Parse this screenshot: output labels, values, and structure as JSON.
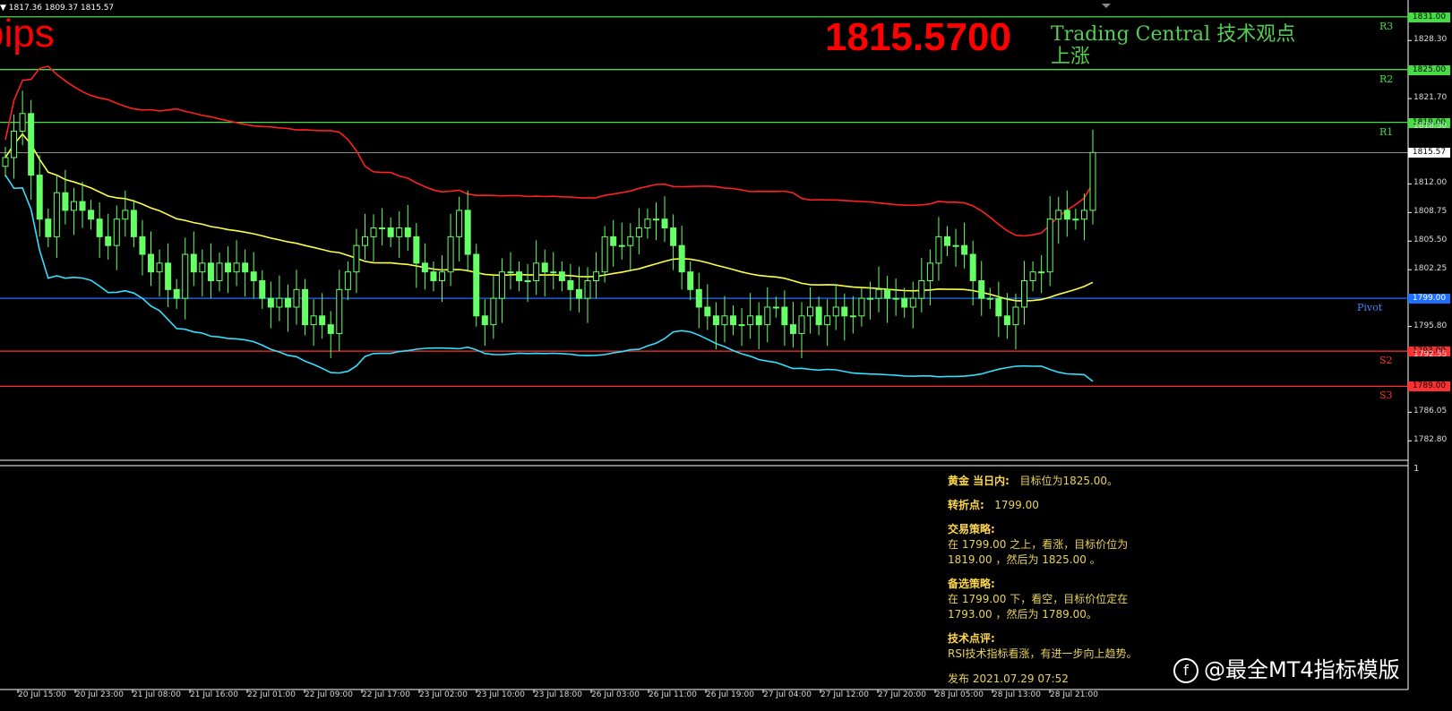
{
  "header": {
    "ohlc_text": "▼ 1817.36 1809.37 1815.57",
    "pips_label": "pips",
    "big_price": "1815.5700",
    "tc_line1": "Trading Central 技术观点",
    "tc_line2": "上涨"
  },
  "levels": [
    {
      "name": "R3",
      "value": 1831.0,
      "tag": "1831.00",
      "color": "#44dd44"
    },
    {
      "name": "R2",
      "value": 1825.0,
      "tag": "1825.00",
      "color": "#44dd44"
    },
    {
      "name": "R1",
      "value": 1819.0,
      "tag": "1819.00",
      "color": "#44dd44"
    },
    {
      "name": "Pivot",
      "value": 1799.0,
      "tag": "1799.00",
      "color": "#1e6fff"
    },
    {
      "name": "S2",
      "value": 1793.0,
      "tag": "1793.00",
      "color": "#ff3030"
    },
    {
      "name": "S3",
      "value": 1789.0,
      "tag": "1789.00",
      "color": "#ff3030"
    }
  ],
  "current_price": {
    "value": 1815.57,
    "tag": "1815.57"
  },
  "y_axis_ticks": [
    "1828.30",
    "1821.70",
    "1818.50",
    "1812.00",
    "1808.75",
    "1805.50",
    "1802.25",
    "1795.80",
    "1792.55",
    "1786.05",
    "1782.80"
  ],
  "x_axis_labels": [
    "20 Jul 15:00",
    "20 Jul 23:00",
    "21 Jul 08:00",
    "21 Jul 16:00",
    "22 Jul 01:00",
    "22 Jul 09:00",
    "22 Jul 17:00",
    "23 Jul 02:00",
    "23 Jul 10:00",
    "23 Jul 18:00",
    "26 Jul 03:00",
    "26 Jul 11:00",
    "26 Jul 19:00",
    "27 Jul 04:00",
    "27 Jul 12:00",
    "27 Jul 20:00",
    "28 Jul 05:00",
    "28 Jul 13:00",
    "28 Jul 21:00"
  ],
  "subwindow_tick": "1",
  "colors": {
    "candle": "#66ff66",
    "ma_red": "#ff2020",
    "ma_yellow": "#ffff44",
    "ma_cyan": "#33e0ff",
    "grid_line": "#bbbbbb"
  },
  "analysis": {
    "title_label": "黄金 当日内:",
    "title_value": "目标位为1825.00。",
    "pivot_label": "转折点:",
    "pivot_value": "1799.00",
    "strategy_label": "交易策略:",
    "strategy_line1": "在 1799.00 之上，看涨，目标价位为",
    "strategy_line2": "1819.00 ，然后为 1825.00 。",
    "alt_label": "备选策略:",
    "alt_line1": "在 1799.00 下，看空，目标价位定在",
    "alt_line2": "1793.00 ，然后为 1789.00。",
    "comment_label": "技术点评:",
    "comment_text": "RSI技术指标看涨，有进一步向上趋势。",
    "published": "发布 2021.07.29 07:52"
  },
  "watermark": {
    "icon_glyph": "f",
    "text": "@最全MT4指标模版"
  },
  "chart_data": {
    "type": "candlestick",
    "symbol": "XAUUSD",
    "ylim": [
      1781.0,
      1832.5
    ],
    "ohlc_last": {
      "open": 1809.37,
      "close": 1815.57,
      "high": 1817.36
    },
    "closes": [
      1815,
      1818,
      1820,
      1813,
      1808,
      1806,
      1811,
      1809,
      1810,
      1809,
      1808,
      1806,
      1805,
      1808,
      1809,
      1806,
      1804,
      1802,
      1803,
      1800,
      1799,
      1804,
      1802,
      1803,
      1801,
      1803,
      1802,
      1803,
      1802,
      1801,
      1799,
      1798,
      1799,
      1798,
      1800,
      1796,
      1797,
      1796,
      1795,
      1800,
      1802,
      1805,
      1806,
      1807,
      1807,
      1806,
      1807,
      1806,
      1803,
      1802,
      1801,
      1802,
      1806,
      1809,
      1804,
      1797,
      1796,
      1799,
      1802,
      1802,
      1801,
      1801,
      1803,
      1802,
      1802,
      1801,
      1800,
      1799,
      1801,
      1802,
      1806,
      1805,
      1805,
      1806,
      1807,
      1808,
      1808,
      1807,
      1805,
      1802,
      1800,
      1798,
      1797,
      1796,
      1797,
      1796,
      1796,
      1797,
      1796,
      1798,
      1798,
      1796,
      1795,
      1797,
      1798,
      1796,
      1797,
      1798,
      1797,
      1797,
      1799,
      1799,
      1800,
      1799,
      1799,
      1798,
      1799,
      1801,
      1803,
      1806,
      1805,
      1805,
      1804,
      1801,
      1799,
      1799,
      1797,
      1796,
      1798,
      1801,
      1802,
      1802,
      1808,
      1809,
      1808,
      1808,
      1809,
      1815.57
    ]
  }
}
